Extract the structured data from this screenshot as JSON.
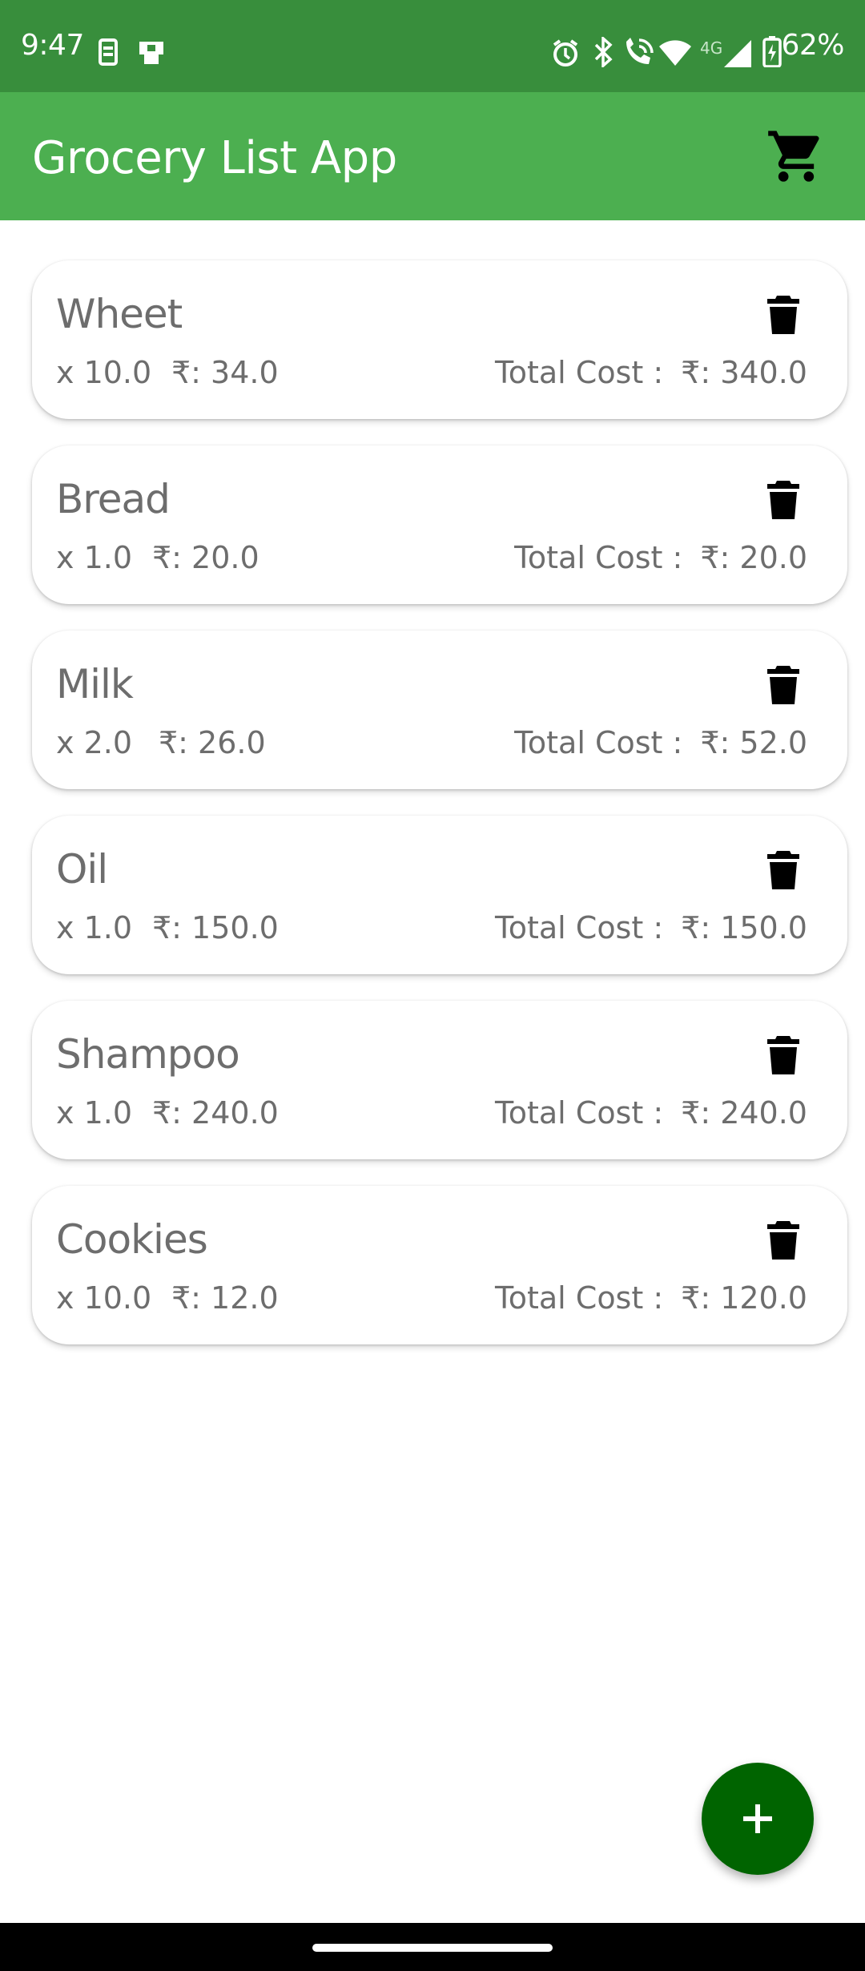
{
  "status_bar": {
    "time": "9:47",
    "network": "4G",
    "battery": "62%",
    "icons": [
      "sim-icon",
      "clipboard-icon",
      "alarm-icon",
      "bluetooth-icon",
      "wifi-call-icon",
      "wifi-icon",
      "signal-icon",
      "battery-icon"
    ]
  },
  "app_bar": {
    "title": "Grocery List App",
    "icon": "shopping-cart-icon",
    "color": "#4caf50"
  },
  "items": [
    {
      "name": "Wheet",
      "qty": "x 10.0",
      "price": "₹: 34.0",
      "total_label": "Total Cost :",
      "total": "₹: 340.0"
    },
    {
      "name": "Bread",
      "qty": "x 1.0",
      "price": "₹: 20.0",
      "total_label": "Total Cost :",
      "total": "₹: 20.0"
    },
    {
      "name": "Milk",
      "qty": "x 2.0",
      "price": "₹: 26.0",
      "total_label": "Total Cost :",
      "total": "₹: 52.0"
    },
    {
      "name": "Oil",
      "qty": "x 1.0",
      "price": "₹: 150.0",
      "total_label": "Total Cost :",
      "total": "₹: 150.0"
    },
    {
      "name": "Shampoo",
      "qty": "x 1.0",
      "price": "₹: 240.0",
      "total_label": "Total Cost :",
      "total": "₹: 240.0"
    },
    {
      "name": "Cookies",
      "qty": "x 10.0",
      "price": "₹: 12.0",
      "total_label": "Total Cost :",
      "total": "₹: 120.0"
    }
  ],
  "fab": {
    "icon": "plus-icon",
    "color": "#006400"
  }
}
